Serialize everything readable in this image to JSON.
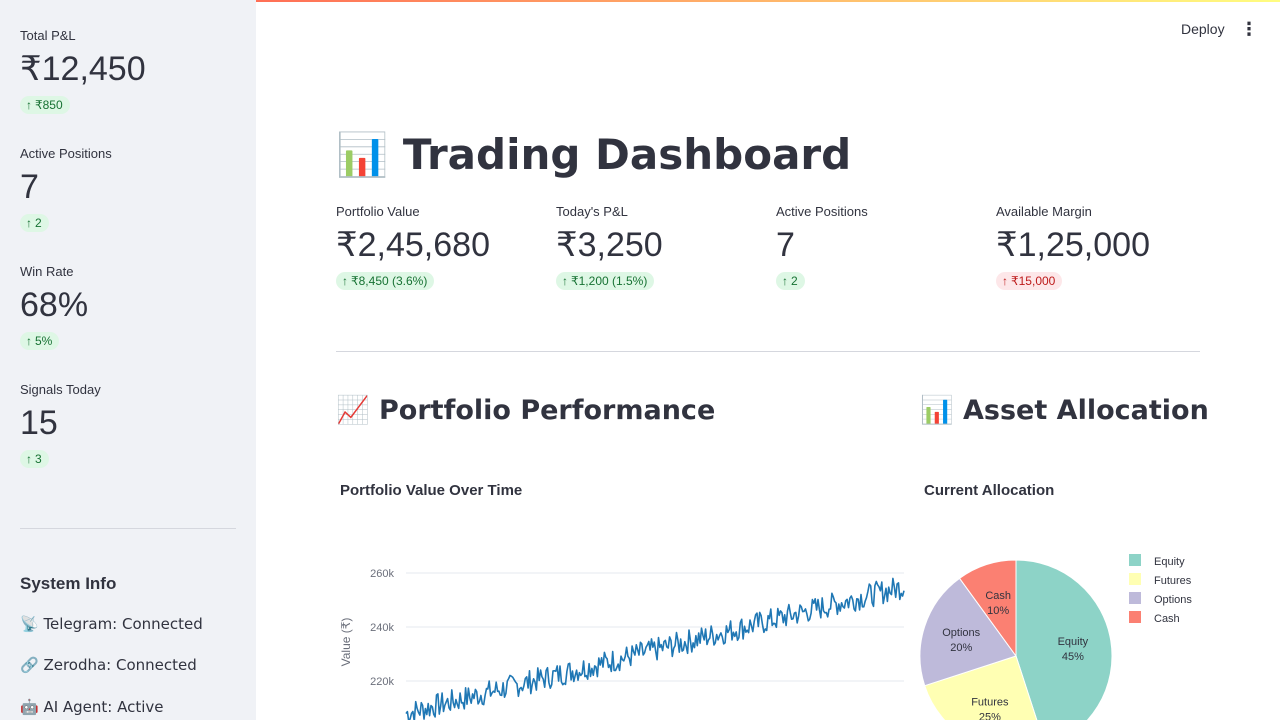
{
  "sidebar": {
    "metrics": [
      {
        "label": "Total P&L",
        "value": "₹12,450",
        "delta": "₹850"
      },
      {
        "label": "Active Positions",
        "value": "7",
        "delta": "2"
      },
      {
        "label": "Win Rate",
        "value": "68%",
        "delta": "5%"
      },
      {
        "label": "Signals Today",
        "value": "15",
        "delta": "3"
      }
    ],
    "system_info": {
      "title": "System Info",
      "lines": [
        "📡 Telegram: Connected",
        "🔗 Zerodha: Connected",
        "🤖 AI Agent: Active"
      ]
    }
  },
  "header": {
    "deploy_label": "Deploy",
    "menu_icon": "kebab-menu-icon"
  },
  "main": {
    "title": "📊 Trading Dashboard",
    "metrics": [
      {
        "label": "Portfolio Value",
        "value": "₹2,45,680",
        "delta": "₹8,450 (3.6%)",
        "status": "up"
      },
      {
        "label": "Today's P&L",
        "value": "₹3,250",
        "delta": "₹1,200 (1.5%)",
        "status": "up"
      },
      {
        "label": "Active Positions",
        "value": "7",
        "delta": "2",
        "status": "up"
      },
      {
        "label": "Available Margin",
        "value": "₹1,25,000",
        "delta": "₹15,000",
        "status": "down"
      }
    ],
    "perf_heading": "📈 Portfolio Performance",
    "alloc_heading": "📊 Asset Allocation"
  },
  "chart_data": [
    {
      "type": "line",
      "title": "Portfolio Value Over Time",
      "ylabel": "Value (₹)",
      "yticks": [
        "220k",
        "240k",
        "260k"
      ],
      "y_start": 208000,
      "y_end": 255000,
      "color": "#1f77b4"
    },
    {
      "type": "pie",
      "title": "Current Allocation",
      "slices": [
        {
          "name": "Equity",
          "value": 45,
          "label": "45%",
          "color": "#8dd3c7"
        },
        {
          "name": "Futures",
          "value": 25,
          "label": "25%",
          "color": "#ffffb3"
        },
        {
          "name": "Options",
          "value": 20,
          "label": "20%",
          "color": "#bebada"
        },
        {
          "name": "Cash",
          "value": 10,
          "label": "10%",
          "color": "#fb8072"
        }
      ]
    }
  ]
}
